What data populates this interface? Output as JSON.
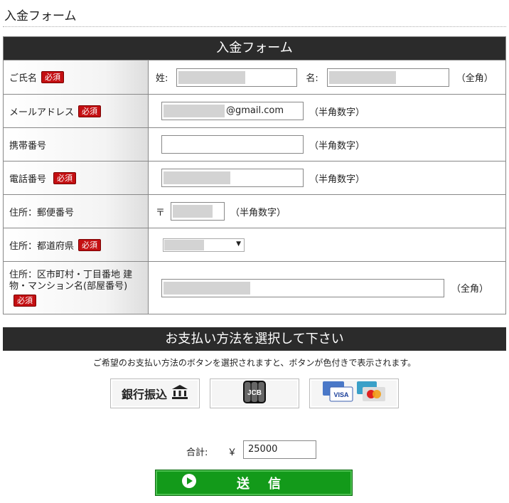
{
  "page": {
    "title": "入金フォーム"
  },
  "form": {
    "heading": "入金フォーム",
    "required_badge": "必須",
    "name": {
      "label": "ご氏名",
      "last_label": "姓:",
      "first_label": "名:",
      "hint": "（全角）"
    },
    "email": {
      "label": "メールアドレス",
      "suffix": "@gmail.com",
      "hint": "（半角数字）"
    },
    "mobile": {
      "label": "携帯番号",
      "hint": "（半角数字）"
    },
    "phone": {
      "label": "電話番号",
      "hint": "（半角数字）"
    },
    "postal": {
      "label": "住所：郵便番号",
      "mark": "〒",
      "hint": "（半角数字）"
    },
    "prefecture": {
      "label": "住所：都道府県",
      "arrow": "▼"
    },
    "address": {
      "label": "住所：区市町村・丁目番地 建物・マンション名(部屋番号)",
      "hint": "（全角）"
    }
  },
  "payment": {
    "heading": "お支払い方法を選択して下さい",
    "note": "ご希望のお支払い方法のボタンを選択されますと、ボタンが色付きで表示されます。",
    "methods": [
      {
        "label": "銀行振込",
        "icon": "bank-icon"
      },
      {
        "label": "JCB",
        "icon": "jcb-card-icon"
      },
      {
        "label": "VISA",
        "icon": "credit-cards-icon"
      }
    ]
  },
  "total": {
    "label": "合計:",
    "currency": "￥",
    "value": "25000"
  },
  "submit": {
    "label": "送　信"
  }
}
